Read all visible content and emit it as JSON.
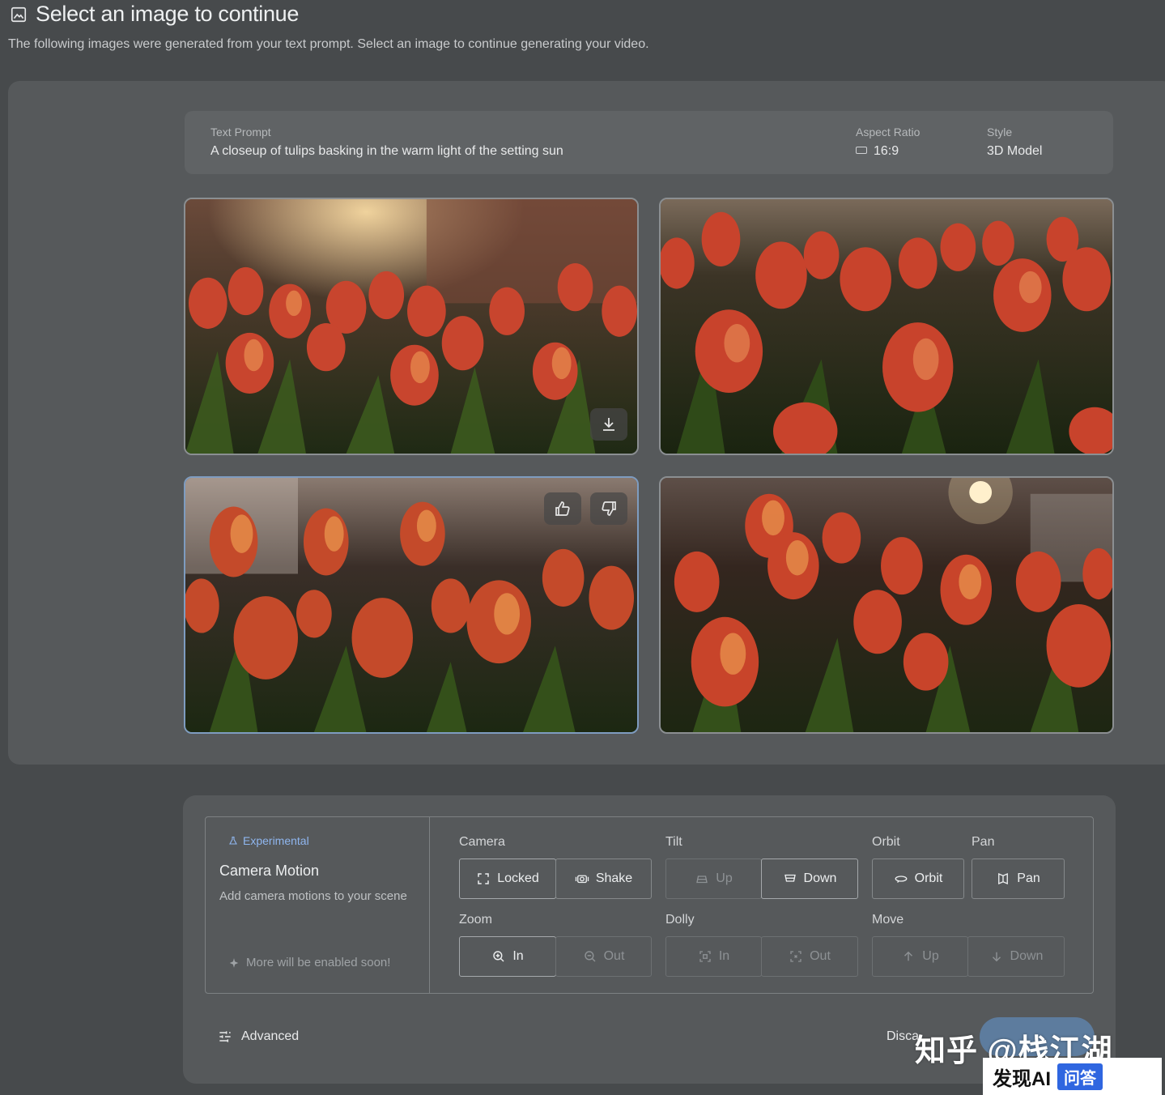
{
  "header": {
    "title": "Select an image to continue",
    "subtitle": "The following images were generated from your text prompt. Select an image to continue generating your video."
  },
  "prompt_bar": {
    "prompt_label": "Text Prompt",
    "prompt_value": "A closeup of tulips basking in the warm light of the setting sun",
    "ratio_label": "Aspect Ratio",
    "ratio_value": "16:9",
    "style_label": "Style",
    "style_value": "3D Model"
  },
  "camera_motion": {
    "badge": "Experimental",
    "title": "Camera Motion",
    "description": "Add camera motions to your scene",
    "soon": "More will be enabled soon!",
    "groups": {
      "camera": {
        "label": "Camera",
        "locked": "Locked",
        "shake": "Shake"
      },
      "tilt": {
        "label": "Tilt",
        "up": "Up",
        "down": "Down"
      },
      "orbit": {
        "label": "Orbit",
        "orbit": "Orbit"
      },
      "pan": {
        "label": "Pan",
        "pan": "Pan"
      },
      "zoom": {
        "label": "Zoom",
        "in": "In",
        "out": "Out"
      },
      "dolly": {
        "label": "Dolly",
        "in": "In",
        "out": "Out"
      },
      "move": {
        "label": "Move",
        "up": "Up",
        "down": "Down"
      }
    }
  },
  "footer": {
    "advanced": "Advanced",
    "discard": "Disca"
  },
  "watermark": {
    "text": "知乎 @栈江湖",
    "logo_main": "发现AI",
    "logo_qa": "问答"
  },
  "colors": {
    "accent": "#8fb6ef",
    "button_blue": "#5d7c9e",
    "selected_border": "#7e9cc0"
  }
}
